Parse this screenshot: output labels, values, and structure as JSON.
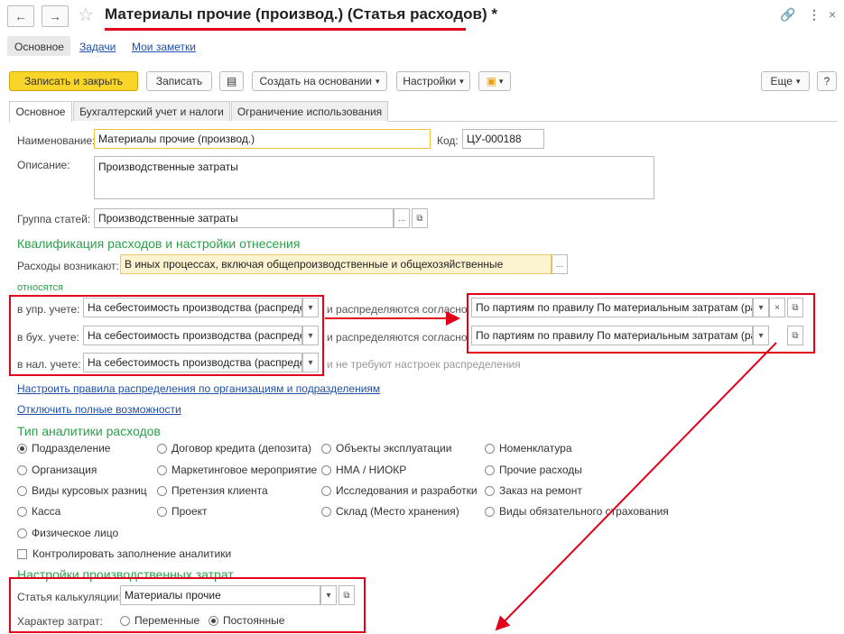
{
  "header": {
    "title": "Материалы прочие (производ.) (Статья расходов) *",
    "back_icon": "arrow-left",
    "forward_icon": "arrow-right",
    "star_icon": "star"
  },
  "section_tabs": [
    "Основное",
    "Задачи",
    "Мои заметки"
  ],
  "toolbar": {
    "save_close": "Записать и закрыть",
    "save": "Записать",
    "create_based": "Создать на основании",
    "settings": "Настройки",
    "more": "Еще",
    "help": "?"
  },
  "tabs": [
    "Основное",
    "Бухгалтерский учет и налоги",
    "Ограничение использования"
  ],
  "form": {
    "name_label": "Наименование:",
    "name_value": "Материалы прочие (производ.)",
    "code_label": "Код:",
    "code_value": "ЦУ-000188",
    "desc_label": "Описание:",
    "desc_value": "Производственные затраты",
    "group_label": "Группа статей:",
    "group_value": "Производственные затраты"
  },
  "qualification": {
    "heading": "Квалификация расходов и настройки отнесения",
    "arise_label": "Расходы возникают:",
    "arise_value": "В иных процессах, включая общепроизводственные и общехозяйственные",
    "relates": "относятся",
    "rows": [
      {
        "label": "в упр. учете:",
        "value": "На себестоимость производства (распреде.",
        "mid": "и распределяются согласно",
        "rule": "По партиям по правилу По материальным затратам (рас"
      },
      {
        "label": "в бух. учете:",
        "value": "На себестоимость производства (распреде.",
        "mid": "и распределяются согласно",
        "rule": "По партиям по правилу По материальным затратам (рас"
      },
      {
        "label": "в нал. учете:",
        "value": "На себестоимость производства (распреде.",
        "mid": "и не требуют настроек распределения"
      }
    ],
    "link_rules": "Настроить правила распределения по организациям и подразделениям",
    "link_disable": "Отключить полные возможности"
  },
  "analytics": {
    "heading": "Тип аналитики расходов",
    "options": [
      "Подразделение",
      "Договор кредита (депозита)",
      "Объекты эксплуатации",
      "Номенклатура",
      "Организация",
      "Маркетинговое мероприятие",
      "НМА / НИОКР",
      "Прочие расходы",
      "Виды курсовых разниц",
      "Претензия клиента",
      "Исследования и разработки",
      "Заказ на ремонт",
      "Касса",
      "Проект",
      "Склад (Место хранения)",
      "Виды обязательного страхования",
      "Физическое лицо"
    ],
    "selected": "Подразделение",
    "control_check": "Контролировать заполнение аналитики"
  },
  "production": {
    "heading": "Настройки производственных затрат",
    "calc_label": "Статья калькуляции:",
    "calc_value": "Материалы прочие",
    "nature_label": "Характер затрат:",
    "variable": "Переменные",
    "constant": "Постоянные",
    "selected": "Постоянные"
  },
  "annotation_color": "#e3001b"
}
